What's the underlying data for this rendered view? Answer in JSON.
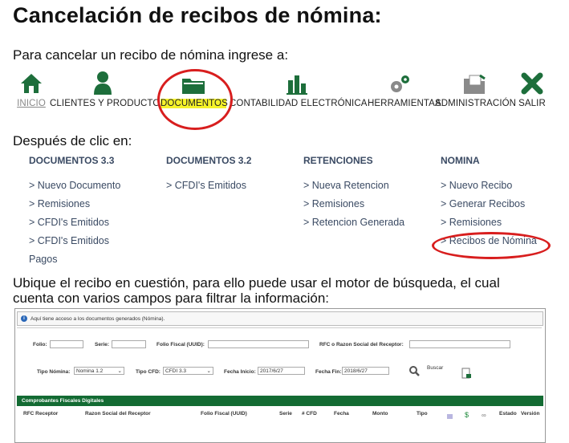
{
  "title": "Cancelación de recibos de nómina:",
  "intro": "Para cancelar un recibo de nómina ingrese a:",
  "nav": [
    {
      "label": "INICIO",
      "icon": "home-icon"
    },
    {
      "label": "CLIENTES Y PRODUCTOS",
      "icon": "user-icon"
    },
    {
      "label": "DOCUMENTOS",
      "icon": "folder-icon"
    },
    {
      "label": "CONTABILIDAD ELECTRÓNICA",
      "icon": "bar-chart-icon"
    },
    {
      "label": "HERRAMIENTAS",
      "icon": "gears-icon"
    },
    {
      "label": "ADMINISTRACIÓN",
      "icon": "admin-folder-icon"
    },
    {
      "label": "SALIR",
      "icon": "close-x-icon"
    }
  ],
  "then": "Después de clic en:",
  "menu": [
    {
      "header": "DOCUMENTOS 3.3",
      "items": [
        "> Nuevo Documento",
        "> Remisiones",
        "> CFDI's Emitidos",
        "> CFDI's Emitidos",
        "Pagos"
      ]
    },
    {
      "header": "DOCUMENTOS 3.2",
      "items": [
        "> CFDI's Emitidos"
      ]
    },
    {
      "header": "RETENCIONES",
      "items": [
        "> Nueva Retencion",
        "> Remisiones",
        "> Retencion Generada"
      ]
    },
    {
      "header": "NOMINA",
      "items": [
        "> Nuevo Recibo",
        "> Generar Recibos",
        "> Remisiones",
        "> Recibos de Nómina"
      ]
    }
  ],
  "locate_line1": "Ubique el recibo en cuestión, para ello puede usar el motor de búsqueda, el cual",
  "locate_line2": "cuenta con varios campos para filtrar la información:",
  "search": {
    "info": "Aquí tiene acceso a los documentos generados (Nómina).",
    "folio_label": "Folio:",
    "serie_label": "Serie:",
    "uuid_label": "Folio Fiscal (UUID):",
    "rfc_label": "RFC o Razon Social del Receptor:",
    "tipo_nomina_label": "Tipo Nómina:",
    "tipo_nomina_value": "Nomina 1.2",
    "tipo_cfd_label": "Tipo CFD:",
    "tipo_cfd_value": "CFDI 3.3",
    "fecha_inicio_label": "Fecha Inicio:",
    "fecha_inicio_value": "2017/6/27",
    "fecha_fin_label": "Fecha Fin:",
    "fecha_fin_value": "2018/6/27",
    "buscar_label": "Buscar",
    "results_title": "Comprobantes Fiscales Digitales",
    "columns": [
      "RFC Receptor",
      "Razon Social del Receptor",
      "Folio Fiscal (UUID)",
      "Serie",
      "# CFD",
      "Fecha",
      "Monto",
      "Tipo",
      "Estado",
      "Versión"
    ]
  },
  "colors": {
    "accent_green": "#136b33",
    "highlight_yellow": "#f5f32a",
    "circle_red": "#d81e1e",
    "menu_text": "#3a4a63"
  }
}
